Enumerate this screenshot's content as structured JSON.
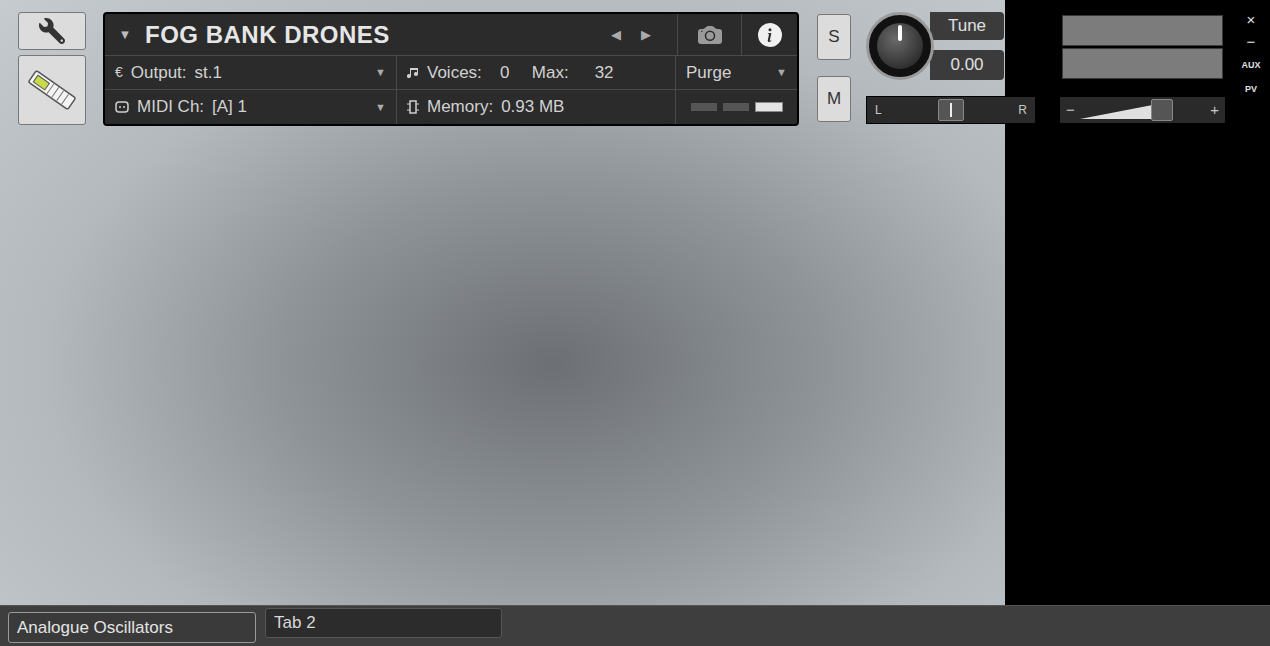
{
  "instrument": {
    "title": "FOG BANK DRONES",
    "collapse_glyph": "▼",
    "prev_glyph": "◀",
    "next_glyph": "▶"
  },
  "output": {
    "glyph": "€",
    "label": "Output:",
    "value": "st.1",
    "dropdown_glyph": "▼"
  },
  "midi": {
    "label": "MIDI Ch:",
    "value": "[A] 1",
    "dropdown_glyph": "▼"
  },
  "voices": {
    "label": "Voices:",
    "value": "0",
    "max_label": "Max:",
    "max_value": "32"
  },
  "memory": {
    "label": "Memory:",
    "value": "0.93 MB"
  },
  "purge": {
    "label": "Purge",
    "dropdown_glyph": "▼"
  },
  "purge_indicators": [
    {
      "on": false
    },
    {
      "on": false
    },
    {
      "on": true
    }
  ],
  "solo": {
    "label": "S",
    "on": false
  },
  "mute": {
    "label": "M",
    "on": false
  },
  "tune": {
    "label": "Tune",
    "value": "0.00",
    "level": 0.5
  },
  "pan": {
    "left": "L",
    "right": "R",
    "level": 0.5
  },
  "meters": [
    {
      "level": 0
    },
    {
      "level": 0
    }
  ],
  "volume": {
    "minus": "−",
    "plus": "+",
    "level": 0.5
  },
  "window_controls": [
    "×",
    "−",
    "AUX",
    "PV"
  ],
  "tabs": [
    {
      "label": "Analogue Oscillators",
      "selected": true
    },
    {
      "label": "Tab 2",
      "selected": false
    }
  ]
}
